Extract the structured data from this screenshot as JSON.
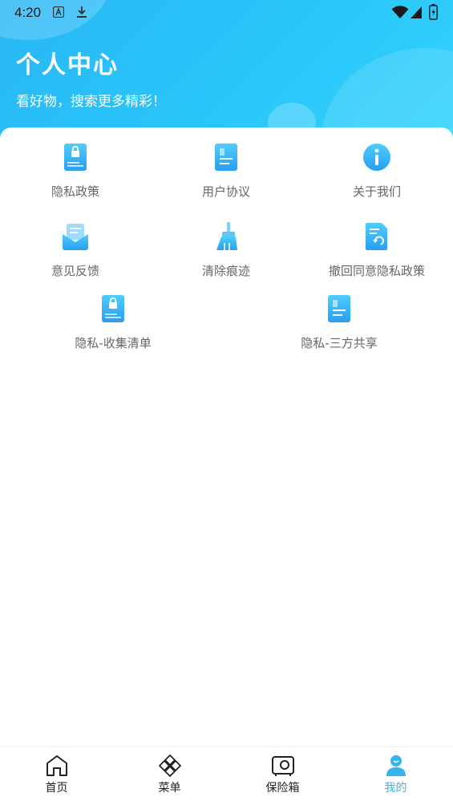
{
  "status_bar": {
    "time": "4:20"
  },
  "header": {
    "title": "个人中心",
    "subtitle": "看好物，搜索更多精彩！"
  },
  "menu": {
    "items": [
      {
        "label": "隐私政策",
        "icon": "lock-document-icon"
      },
      {
        "label": "用户协议",
        "icon": "document-icon"
      },
      {
        "label": "关于我们",
        "icon": "info-icon"
      },
      {
        "label": "意见反馈",
        "icon": "feedback-mail-icon"
      },
      {
        "label": "清除痕迹",
        "icon": "broom-icon"
      },
      {
        "label": "撤回同意隐私政策",
        "icon": "revoke-document-icon"
      },
      {
        "label": "隐私-收集清单",
        "icon": "lock-document-icon"
      },
      {
        "label": "隐私-三方共享",
        "icon": "document-icon"
      }
    ]
  },
  "bottom_nav": {
    "items": [
      {
        "label": "首页",
        "icon": "home-icon"
      },
      {
        "label": "菜单",
        "icon": "menu-diamond-icon"
      },
      {
        "label": "保险箱",
        "icon": "safe-icon"
      },
      {
        "label": "我的",
        "icon": "profile-icon",
        "active": true
      }
    ]
  },
  "colors": {
    "accent": "#35b4ef",
    "header_gradient_start": "#2ab7f6",
    "header_gradient_end": "#35d4fd"
  }
}
